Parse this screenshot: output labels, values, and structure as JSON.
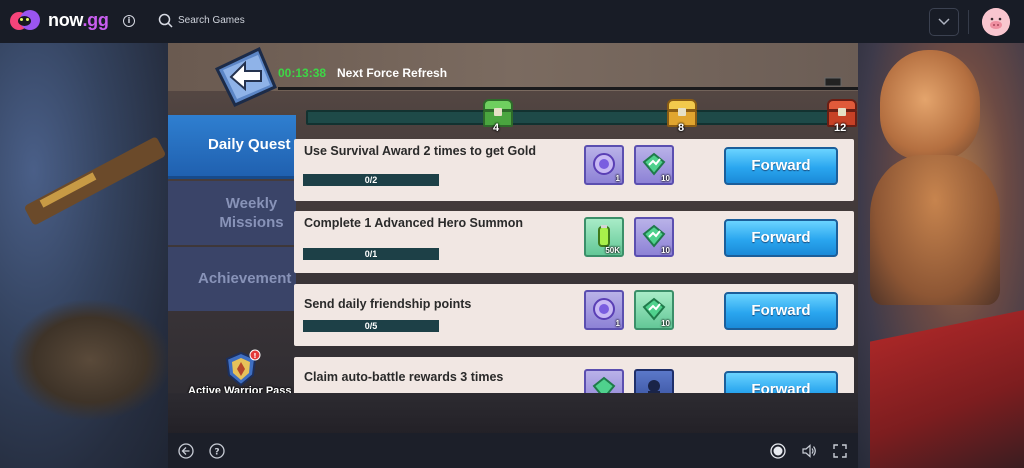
{
  "header": {
    "brand_name": "now",
    "brand_tld": ".gg",
    "search_label": "Search Games",
    "icons": [
      "now-gg-logo-icon",
      "info-icon",
      "search-icon",
      "chevron-down-icon",
      "user-avatar"
    ]
  },
  "game": {
    "timer": "00:13:38",
    "refresh_label": "Next Force Refresh",
    "milestones": [
      {
        "value": "4",
        "icon": "green-chest-icon"
      },
      {
        "value": "8",
        "icon": "gold-chest-icon"
      },
      {
        "value": "12",
        "icon": "red-chest-icon"
      }
    ],
    "tabs": [
      {
        "label": "Daily Quest",
        "active": true
      },
      {
        "label": "Weekly Missions",
        "active": false
      },
      {
        "label": "Achievement",
        "active": false
      }
    ],
    "warrior_pass_label": "Active Warrior Pass",
    "quests": [
      {
        "title": "Use Survival Award 2 times to get Gold",
        "progress": "0/2",
        "rewards": [
          {
            "icon": "purple-coin-icon",
            "qty": "1"
          },
          {
            "icon": "green-gem-icon",
            "qty": "10"
          }
        ],
        "button": "Forward"
      },
      {
        "title": "Complete 1 Advanced Hero Summon",
        "progress": "0/1",
        "rewards": [
          {
            "icon": "green-battery-icon",
            "qty": "50K"
          },
          {
            "icon": "green-gem-icon",
            "qty": "10"
          }
        ],
        "button": "Forward"
      },
      {
        "title": "Send daily friendship points",
        "progress": "0/5",
        "rewards": [
          {
            "icon": "purple-coin-icon",
            "qty": "1"
          },
          {
            "icon": "green-gem-icon",
            "qty": "10"
          }
        ],
        "button": "Forward"
      },
      {
        "title": "Claim auto-battle rewards 3 times",
        "progress": "",
        "rewards": [
          {
            "icon": "green-gem-icon",
            "qty": ""
          },
          {
            "icon": "hero-portrait-icon",
            "qty": ""
          }
        ],
        "button": "Forward"
      }
    ]
  },
  "controls": {
    "icons": [
      "back-arrow-icon",
      "help-icon",
      "record-icon",
      "volume-icon",
      "fullscreen-icon"
    ]
  },
  "colors": {
    "timer": "#3ed646",
    "forward_button": "#2aa6ef",
    "active_tab": "#2f7fd0"
  }
}
